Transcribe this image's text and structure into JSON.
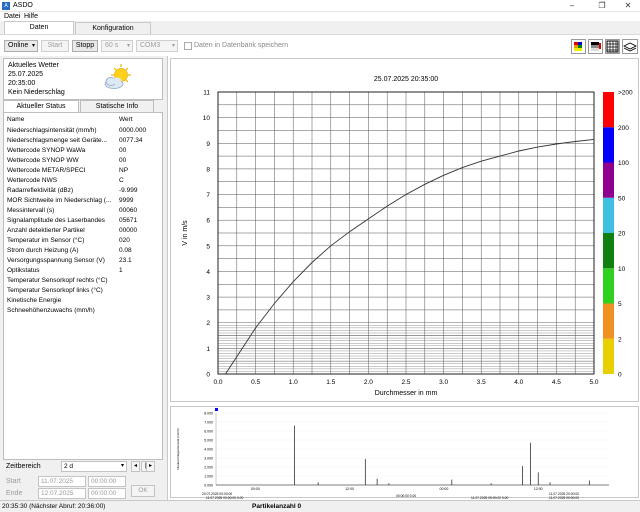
{
  "window": {
    "title": "ASDO"
  },
  "menu": {
    "items": [
      "Datei",
      "Hilfe"
    ]
  },
  "tabs": [
    "Daten",
    "Konfiguration"
  ],
  "toolbar": {
    "mode": "Online",
    "start": "Start",
    "stop": "Stopp",
    "interval": "60 s",
    "port": "COM3",
    "db_label": "Daten in Datenbank speichern"
  },
  "weather": {
    "title": "Aktuelles Wetter",
    "date": "25.07.2025",
    "time": "20:35:00",
    "condition": "Kein Niederschlag"
  },
  "status_tabs": [
    "Aktueller Status",
    "Statische Info"
  ],
  "status_table": {
    "headers": [
      "Name",
      "Wert"
    ],
    "rows": [
      [
        "Niederschlagsintensität (mm/h)",
        "0000.000"
      ],
      [
        "Niederschlagsmenge seit Geräte...",
        "0077.34"
      ],
      [
        "Wettercode SYNOP WaWa",
        "00"
      ],
      [
        "Wettercode SYNOP WW",
        "00"
      ],
      [
        "Wettercode METAR/SPECI",
        "NP"
      ],
      [
        "Wettercode NWS",
        "C"
      ],
      [
        "Radarreflektivität (dBz)",
        "-9.999"
      ],
      [
        "MOR Sichtweite im Niederschlag (...",
        "9999"
      ],
      [
        "Messintervall (s)",
        "00060"
      ],
      [
        "Signalamplitude des Laserbandes",
        "05671"
      ],
      [
        "Anzahl detektierter Partikel",
        "00000"
      ],
      [
        "Temperatur im Sensor (°C)",
        "020"
      ],
      [
        "Strom durch Heizung (A)",
        "0.08"
      ],
      [
        "Versorgungsspannung Sensor (V)",
        "23.1"
      ],
      [
        "Optikstatus",
        "1"
      ],
      [
        "Temperatur Sensorkopf rechts (°C)",
        ""
      ],
      [
        "Temperatur Sensorkopf links (°C)",
        ""
      ],
      [
        "Kinetische Energie",
        ""
      ],
      [
        "Schneehöhenzuwachs (mm/h)",
        ""
      ]
    ]
  },
  "time_range": {
    "label": "Zeitbereich",
    "value": "2 d",
    "start_label": "Start",
    "end_label": "Ende",
    "start_date": "11.07.2025",
    "start_time": "00:00:00",
    "end_date": "12.07.2025",
    "end_time": "00:00:00",
    "ok": "OK"
  },
  "chart_data": {
    "type": "line",
    "title": "25.07.2025  20:35:00",
    "xlabel": "Durchmesser in mm",
    "ylabel": "V in m/s",
    "xlim": [
      0,
      5
    ],
    "ylim": [
      0,
      11
    ],
    "x_ticks": [
      "0.0",
      "0.5",
      "1.0",
      "1.5",
      "2.0",
      "2.5",
      "3.0",
      "3.5",
      "4.0",
      "4.5",
      "5.0"
    ],
    "y_ticks": [
      "0",
      "1",
      "2",
      "3",
      "4",
      "5",
      "6",
      "7",
      "8",
      "9",
      "10",
      "11"
    ],
    "x": [
      0.1,
      0.3,
      0.5,
      0.75,
      1.0,
      1.25,
      1.5,
      1.75,
      2.0,
      2.25,
      2.5,
      2.75,
      3.0,
      3.25,
      3.5,
      3.75,
      4.0,
      4.25,
      4.5,
      4.75,
      5.0
    ],
    "y": [
      0.0,
      0.9,
      1.8,
      2.75,
      3.6,
      4.35,
      5.0,
      5.55,
      6.05,
      6.55,
      7.0,
      7.4,
      7.75,
      8.05,
      8.3,
      8.5,
      8.7,
      8.85,
      8.97,
      9.07,
      9.15
    ],
    "legend": [
      "0",
      "2",
      "5",
      "10",
      "20",
      "50",
      "100",
      "200",
      ">200"
    ],
    "legend_colors": [
      "#e8d000",
      "#f09020",
      "#30d020",
      "#108010",
      "#40c0e0",
      "#900090",
      "#0000ff",
      "#ff0000"
    ]
  },
  "histogram": {
    "ylabel": "Niederschlagsintensität (mm/h)",
    "y_ticks": [
      "8.000",
      "7.000",
      "6.000",
      "5.000",
      "4.000",
      "3.000",
      "2.000",
      "1.000",
      "0.000"
    ],
    "time_ticks": [
      "00:00",
      "12:00",
      "00:00",
      "12:00"
    ],
    "start_label": "20.07.2025 00:00:00",
    "start_sub": "11.07.2025 00:00:00",
    "start_dur": "0.00",
    "mid_label": "00:00:00",
    "mid_dur": "0.00",
    "end_label": "11.07.2025 05:00:22",
    "end_dur": "0.00",
    "end_right": "11.07.2025 20:00:00",
    "end_right2": "11.07.2025 00:00:00",
    "spikes": [
      {
        "t": 0.2,
        "v": 6.6
      },
      {
        "t": 0.26,
        "v": 0.3
      },
      {
        "t": 0.38,
        "v": 2.9
      },
      {
        "t": 0.41,
        "v": 0.7
      },
      {
        "t": 0.44,
        "v": 0.2
      },
      {
        "t": 0.6,
        "v": 0.6
      },
      {
        "t": 0.7,
        "v": 0.2
      },
      {
        "t": 0.78,
        "v": 2.1
      },
      {
        "t": 0.8,
        "v": 4.7
      },
      {
        "t": 0.82,
        "v": 1.4
      },
      {
        "t": 0.85,
        "v": 0.3
      },
      {
        "t": 0.95,
        "v": 0.5
      }
    ]
  },
  "statusbar": {
    "left": "20:35:30 (Nächster Abruf: 20:36:00)",
    "center": "Partikelanzahl 0"
  }
}
